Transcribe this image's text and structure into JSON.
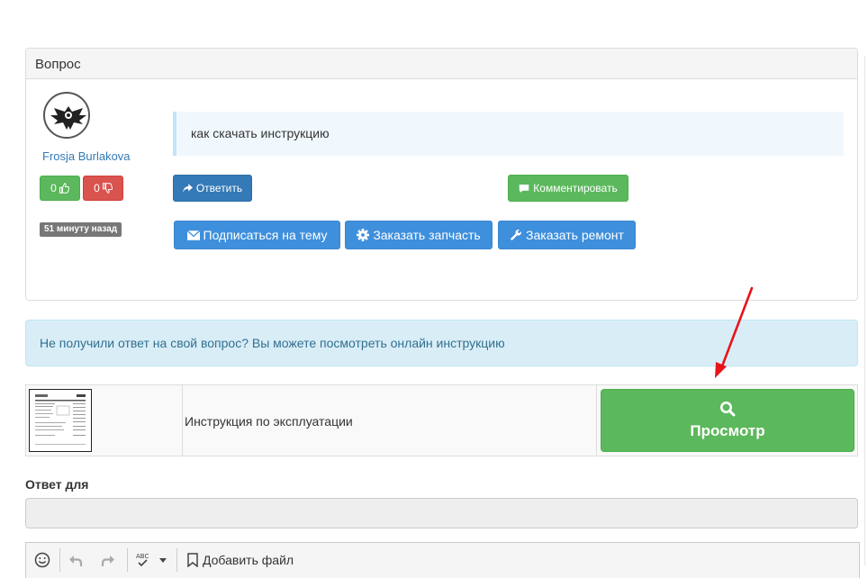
{
  "question_panel": {
    "heading": "Вопрос",
    "author": "Frosja Burlakova",
    "votes": {
      "up": "0",
      "down": "0"
    },
    "time": "51 минуту назад",
    "question": "как скачать инструкцию",
    "buttons": {
      "reply": "Ответить",
      "comment": "Комментировать",
      "subscribe": "Подписаться на тему",
      "order_part": "Заказать запчасть",
      "order_repair": "Заказать ремонт"
    }
  },
  "info_alert": "Не получили ответ на свой вопрос? Вы можете посмотреть онлайн инструкцию",
  "manual": {
    "title": "Инструкция по эксплуатации",
    "view_button": "Просмотр"
  },
  "answer": {
    "label": "Ответ для",
    "value": ""
  },
  "editor": {
    "add_file": "Добавить файл",
    "spellcheck_glyph": "ABC"
  },
  "colors": {
    "primary": "#337ab7",
    "success": "#5cb85c",
    "danger": "#d9534f",
    "info_bg": "#d9edf7",
    "info_text": "#31708f",
    "action_blue": "#3e8fdc",
    "annotation_arrow": "#e8141b"
  }
}
